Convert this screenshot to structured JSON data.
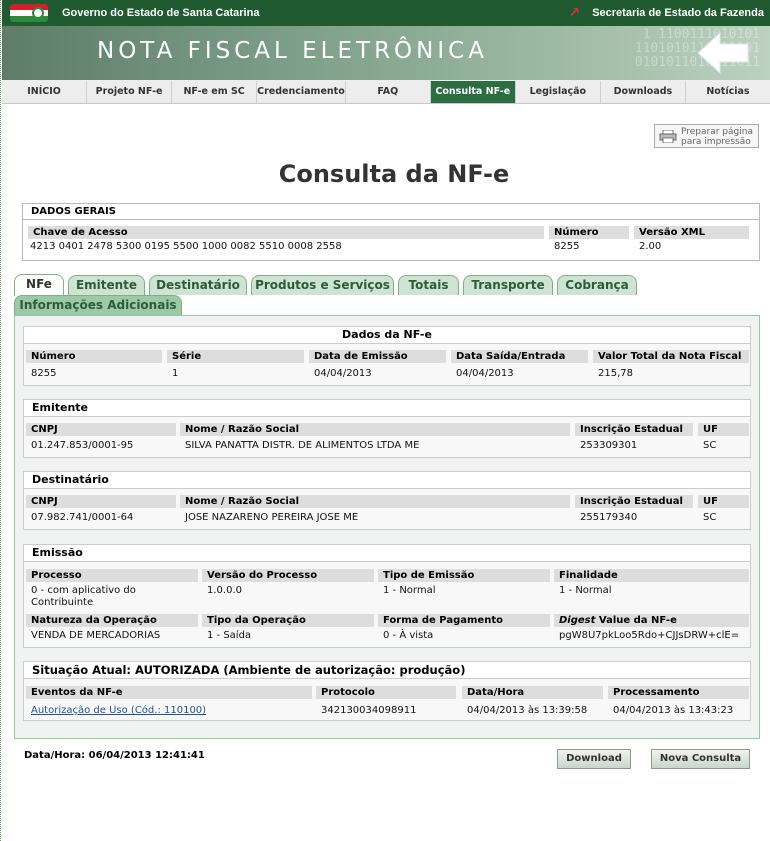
{
  "header": {
    "gov_name": "Governo do Estado de Santa Catarina",
    "secretaria": "Secretaria de Estado da Fazenda",
    "banner_title": "NOTA FISCAL ELETRÔNICA",
    "binary_1": "1  1100111010101",
    "binary_2": "1101010110111001",
    "binary_3": "0101011010111011"
  },
  "nav": {
    "items": [
      "INÍCIO",
      "Projeto NF-e",
      "NF-e em SC",
      "Credenciamento",
      "FAQ",
      "Consulta NF-e",
      "Legislação",
      "Downloads",
      "Notícias"
    ],
    "active_index": 5,
    "active_color": "#2a6e42"
  },
  "print": {
    "line1": "Preparar página",
    "line2": "para impressão"
  },
  "page_title": "Consulta da NF-e",
  "dados_gerais": {
    "heading": "DADOS GERAIS",
    "chave_label": "Chave de Acesso",
    "chave_value": "4213 0401 2478 5300 0195 5500 1000 0082 5510 0008 2558",
    "numero_label": "Número",
    "numero_value": "8255",
    "versao_label": "Versão XML",
    "versao_value": "2.00"
  },
  "tabs": [
    "NFe",
    "Emitente",
    "Destinatário",
    "Produtos e Serviços",
    "Totais",
    "Transporte",
    "Cobrança",
    "Informações Adicionais"
  ],
  "nfe": {
    "heading": "Dados da NF-e",
    "labels": [
      "Número",
      "Série",
      "Data de Emissão",
      "Data Saída/Entrada",
      "Valor Total da Nota Fiscal"
    ],
    "values": [
      "8255",
      "1",
      "04/04/2013",
      "04/04/2013",
      "215,78"
    ]
  },
  "emitente": {
    "heading": "Emitente",
    "labels": [
      "CNPJ",
      "Nome / Razão Social",
      "Inscrição Estadual",
      "UF"
    ],
    "values": [
      "01.247.853/0001-95",
      "SILVA PANATTA DISTR. DE ALIMENTOS LTDA ME",
      "253309301",
      "SC"
    ]
  },
  "destinatario": {
    "heading": "Destinatário",
    "labels": [
      "CNPJ",
      "Nome / Razão Social",
      "Inscrição Estadual",
      "UF"
    ],
    "values": [
      "07.982.741/0001-64",
      "JOSE NAZARENO PEREIRA JOSE ME",
      "255179340",
      "SC"
    ]
  },
  "emissao": {
    "heading": "Emissão",
    "labels1": [
      "Processo",
      "Versão do Processo",
      "Tipo de Emissão",
      "Finalidade"
    ],
    "values1": [
      "0 - com aplicativo do Contribuinte",
      "1.0.0.0",
      "1 - Normal",
      "1 - Normal"
    ],
    "labels2": [
      "Natureza da Operação",
      "Tipo da Operação",
      "Forma de Pagamento",
      "Digest",
      " Value da NF-e"
    ],
    "values2": [
      "VENDA DE MERCADORIAS",
      "1 - Saída",
      "0 - À vista",
      "pgW8U7pkLoo5Rdo+CJJsDRW+clE="
    ]
  },
  "situacao": {
    "heading": "Situação Atual:  AUTORIZADA (Ambiente de autorização: produção)",
    "labels": [
      "Eventos da NF-e",
      "Protocolo",
      "Data/Hora",
      "Processamento"
    ],
    "event_link": "Autorização de Uso (Cód.: 110100)",
    "protocolo": "342130034098911",
    "data_hora": "04/04/2013 às 13:39:58",
    "processamento": "04/04/2013 às 13:43:23"
  },
  "footer": {
    "datetime": "Data/Hora: 06/04/2013 12:41:41",
    "download_label": "Download",
    "nova_label": "Nova Consulta"
  }
}
